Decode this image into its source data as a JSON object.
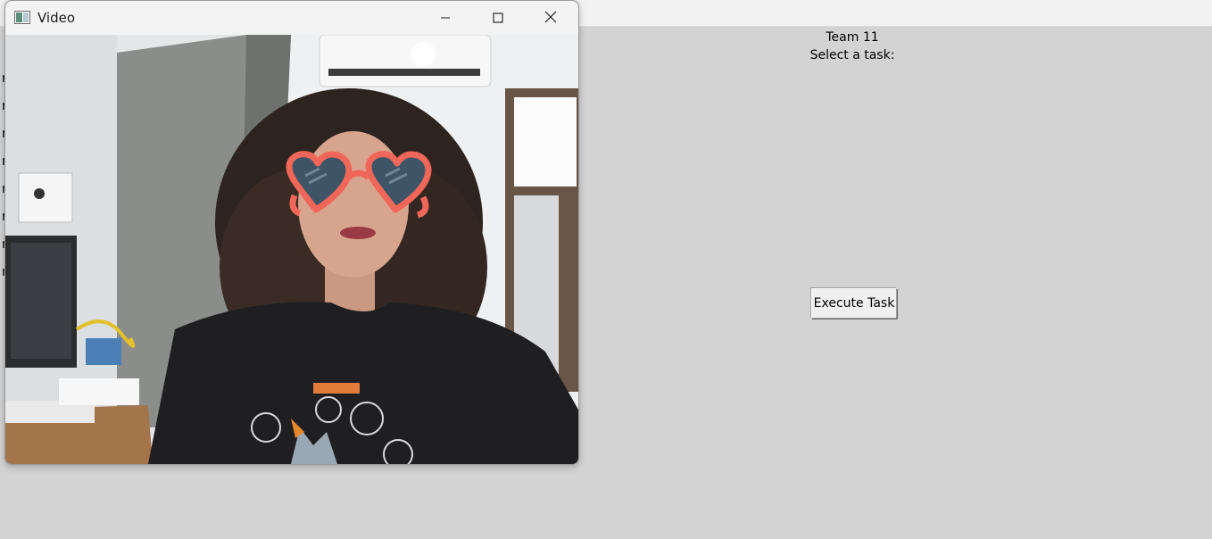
{
  "main_window": {
    "team_label": "Team 11",
    "task_prompt": "Select a task:",
    "execute_button_label": "Execute Task",
    "list_stubs": [
      "r",
      "r",
      "r",
      "r",
      "r",
      "r",
      "r",
      "r"
    ]
  },
  "video_window": {
    "title": "Video",
    "controls": [
      "minimize-icon",
      "maximize-icon",
      "close-icon"
    ]
  },
  "colors": {
    "background": "#d3d3d3",
    "titlebar": "#f3f3f3",
    "glasses": "#f0675a",
    "lens": "#3d5566"
  }
}
